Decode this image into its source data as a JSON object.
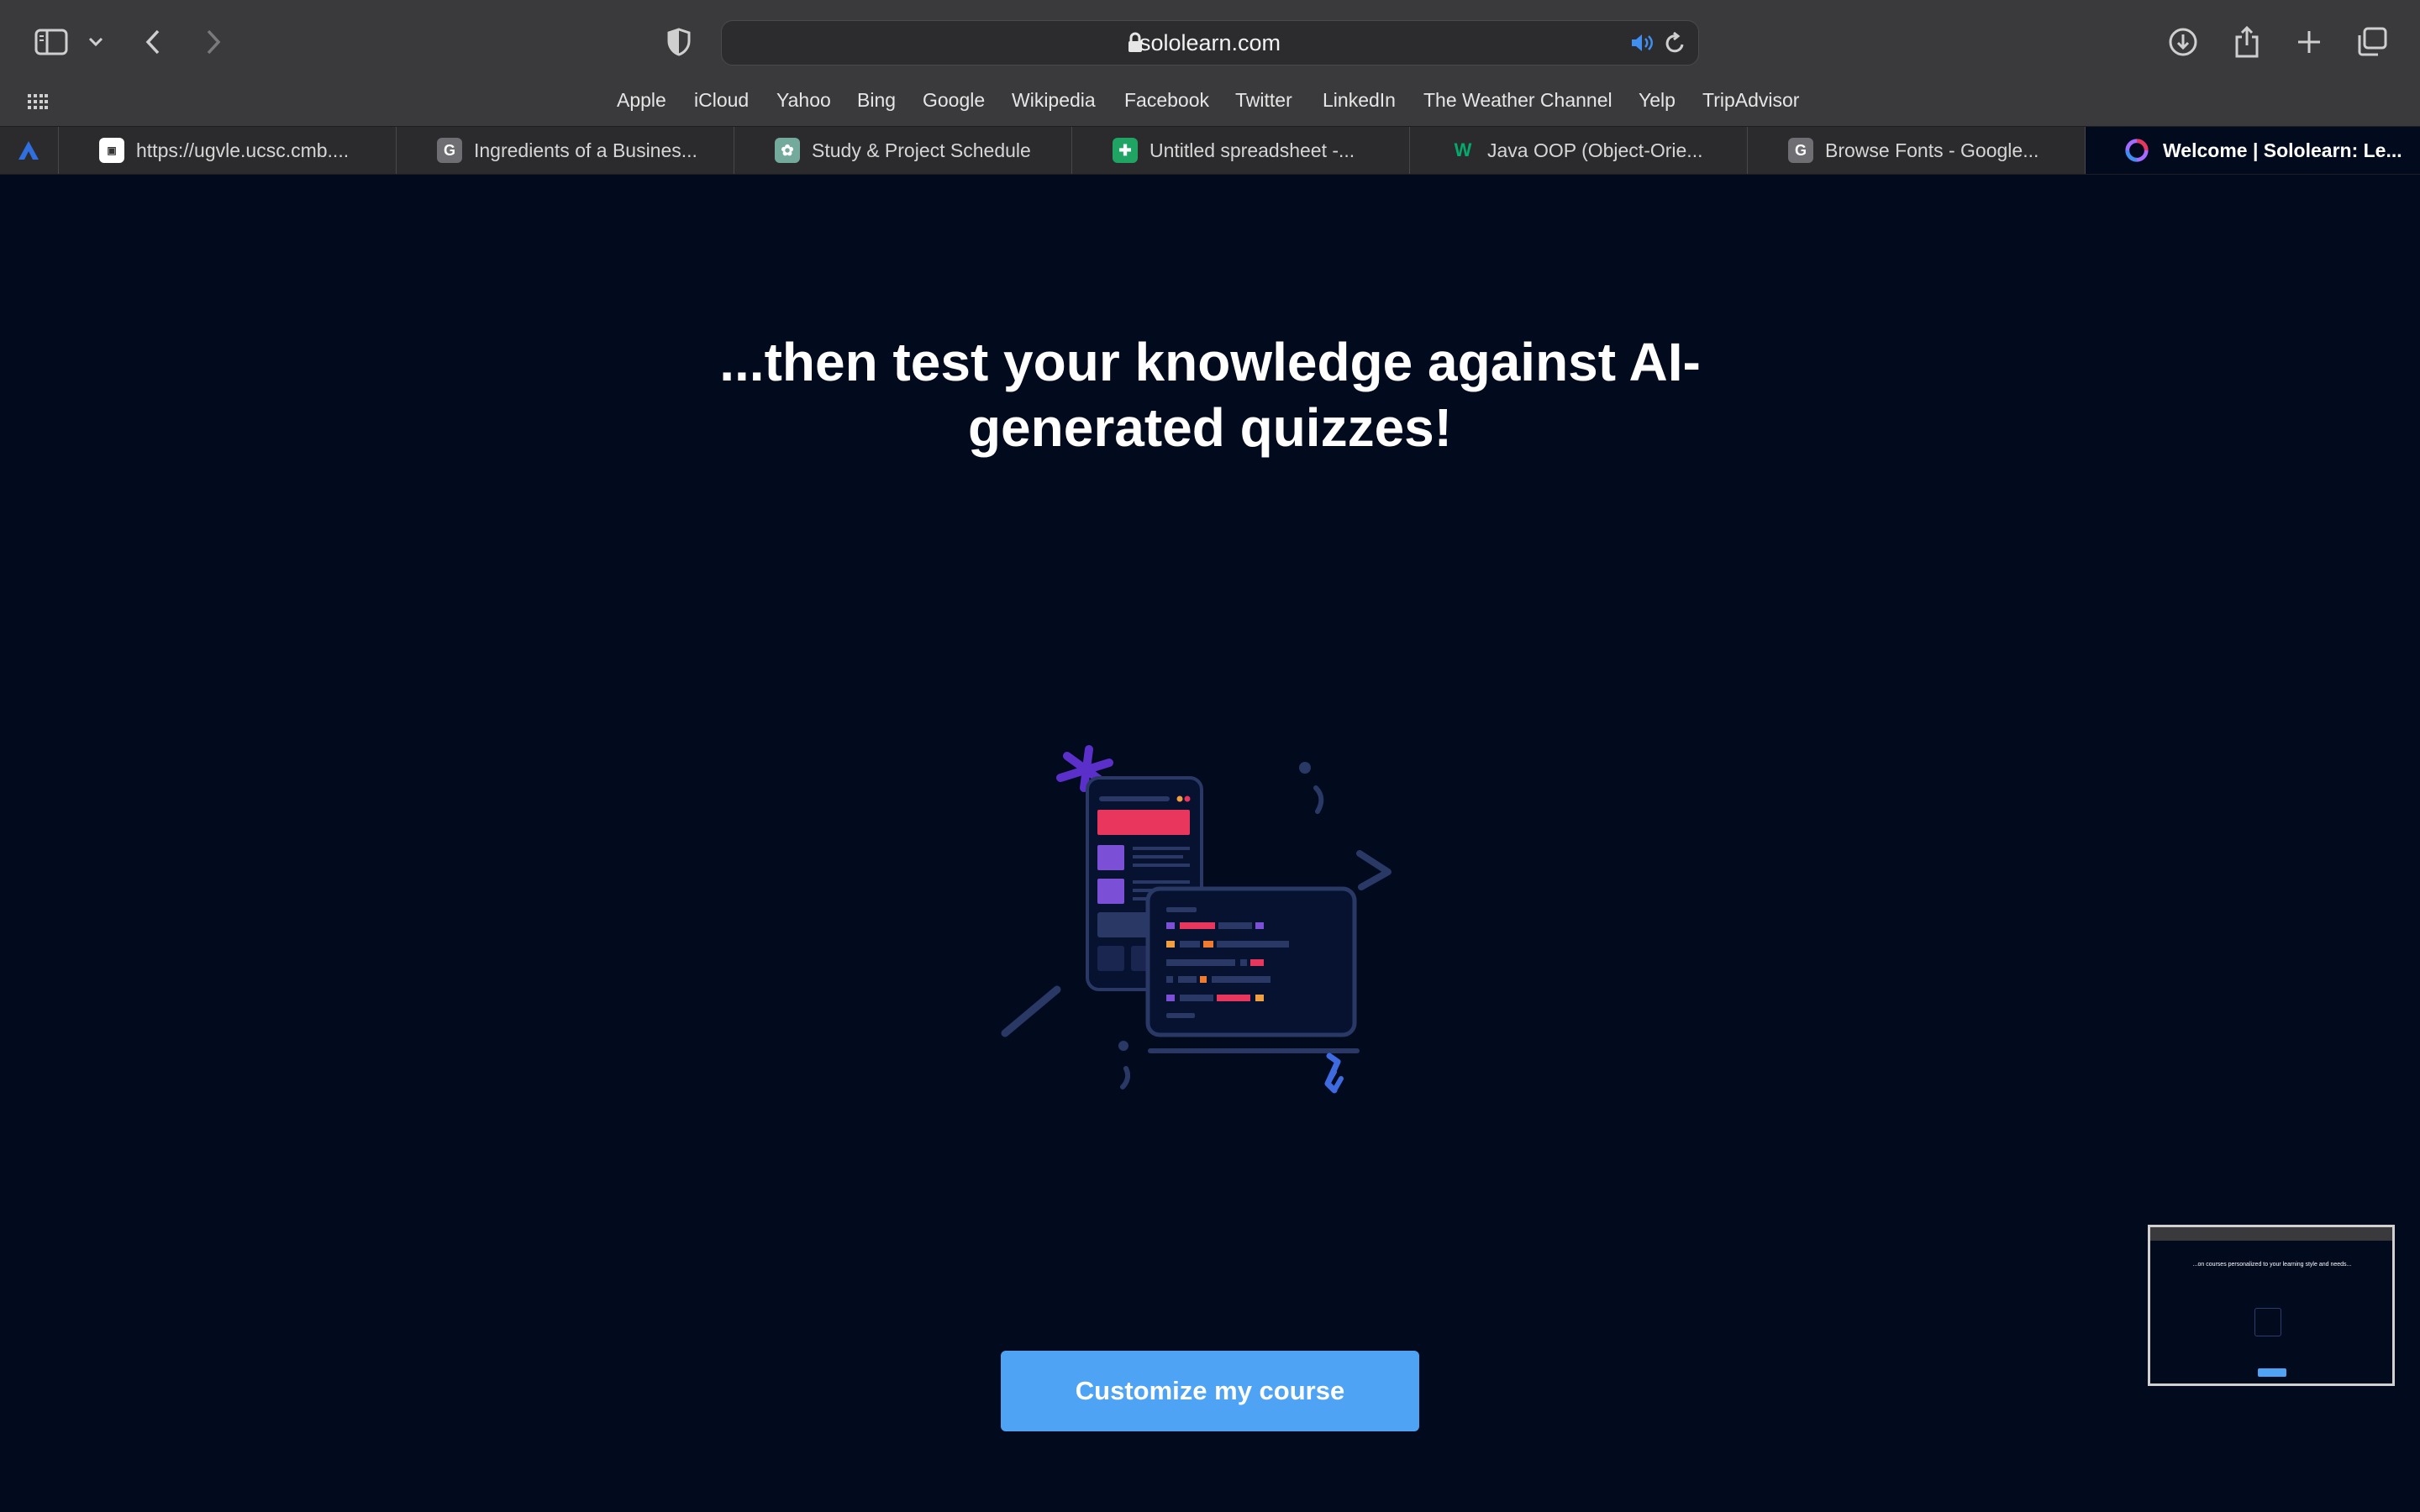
{
  "browser": {
    "url_host": "sololearn.com",
    "favorites": [
      "Apple",
      "iCloud",
      "Yahoo",
      "Bing",
      "Google",
      "Wikipedia",
      "Facebook",
      "Twitter",
      "LinkedIn",
      "The Weather Channel",
      "Yelp",
      "TripAdvisor"
    ],
    "tabs": [
      {
        "label": "https://ugvle.ucsc.cmb....",
        "icon": "site-logo-icon",
        "icon_color": "#ffffff"
      },
      {
        "label": "Ingredients of a Busines...",
        "icon": "G",
        "icon_color": "#6e6e73"
      },
      {
        "label": "Study & Project Schedule",
        "icon": "chatgpt-icon",
        "icon_color": "#74aa9c"
      },
      {
        "label": "Untitled spreadsheet -...",
        "icon": "sheets-icon",
        "icon_color": "#1fa463"
      },
      {
        "label": "Java OOP (Object-Orie...",
        "icon": "w3-icon",
        "icon_color": "#04aa6d"
      },
      {
        "label": "Browse Fonts - Google...",
        "icon": "G",
        "icon_color": "#6e6e73"
      },
      {
        "label": "Welcome | Sololearn: Le...",
        "icon": "sololearn-icon",
        "icon_color": "#a36bff"
      }
    ]
  },
  "page": {
    "headline": "...then test your knowledge against AI-generated quizzes!",
    "cta_label": "Customize my course",
    "thumbnail_text": "...on courses personalized to your learning style and needs..."
  },
  "colors": {
    "background": "#020a1e",
    "cta": "#4fa3f4",
    "accent_pink": "#e8365d",
    "accent_purple": "#7b4fd6"
  }
}
